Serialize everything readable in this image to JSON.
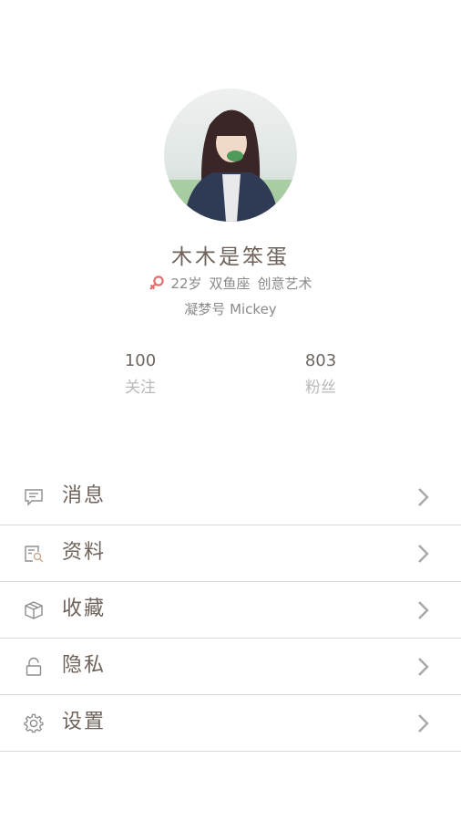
{
  "profile": {
    "name": "木木是笨蛋",
    "gender_icon": "female-symbol-icon",
    "age": "22岁",
    "zodiac": "双鱼座",
    "tag": "创意艺术",
    "uid": "凝梦号 Mickey",
    "avatar_icon": "profile-photo"
  },
  "stats": [
    {
      "value": "100",
      "label": "关注"
    },
    {
      "value": "803",
      "label": "粉丝"
    }
  ],
  "menu": [
    {
      "label": "消息",
      "icon": "message-icon"
    },
    {
      "label": "资料",
      "icon": "profile-card-icon"
    },
    {
      "label": "收藏",
      "icon": "box-icon"
    },
    {
      "label": "隐私",
      "icon": "lock-icon"
    },
    {
      "label": "设置",
      "icon": "gear-icon"
    }
  ],
  "colors": {
    "text_primary": "#6e625a",
    "text_secondary": "#8a8a8a",
    "text_muted": "#b9b9b9",
    "gender_accent": "#e0706e",
    "divider": "#d9d9d9",
    "chevron": "#a8a8a8"
  }
}
